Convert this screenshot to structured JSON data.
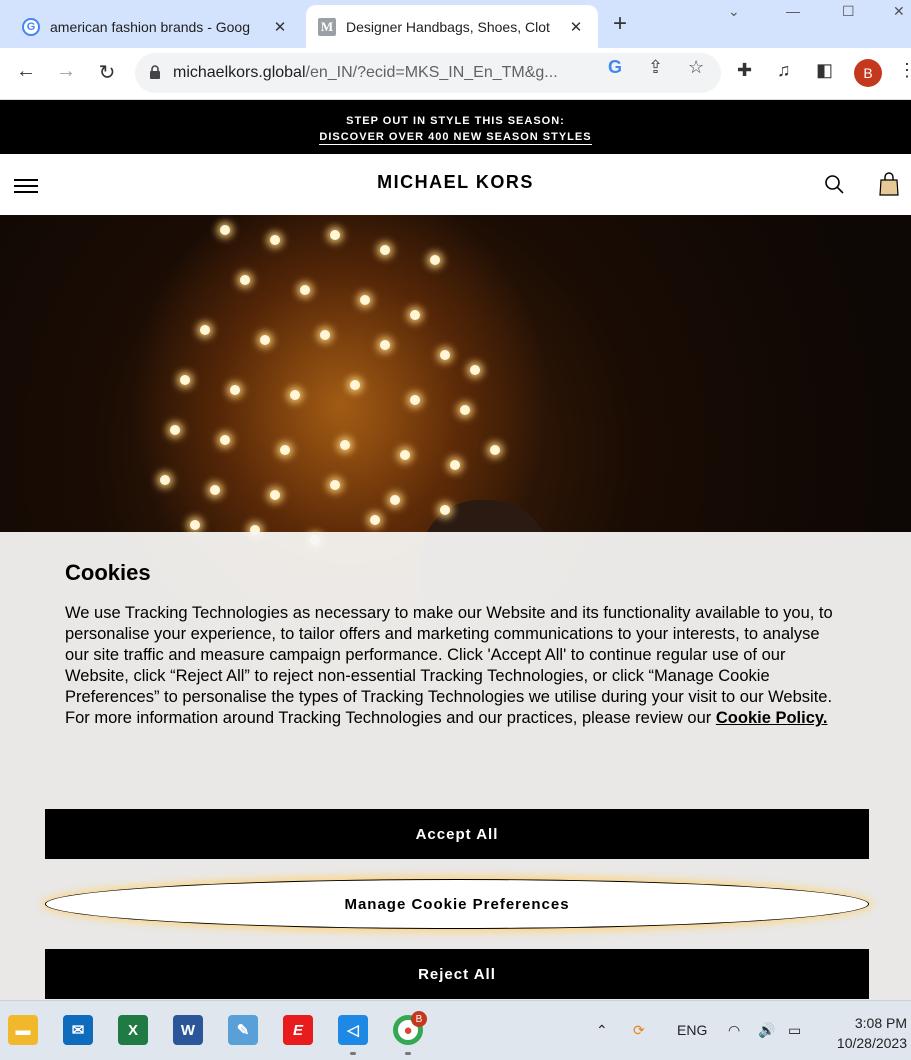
{
  "browser": {
    "tabs": [
      {
        "title": "american fashion brands - Goog",
        "favicon": "G"
      },
      {
        "title": "Designer Handbags, Shoes, Clot",
        "favicon": "M"
      }
    ],
    "url_host": "michaelkors.global",
    "url_path": "/en_IN/?ecid=MKS_IN_En_TM&g...",
    "profile_initial": "B"
  },
  "promo": {
    "line1": "STEP OUT IN STYLE THIS SEASON:",
    "line2": "DISCOVER OVER 400 NEW SEASON STYLES"
  },
  "header": {
    "logo": "MICHAEL KORS"
  },
  "cookie": {
    "title": "Cookies",
    "body": "We use Tracking Technologies as necessary to make our Website and its functionality available to you, to personalise your experience, to tailor offers and marketing communications to your interests, to analyse our site traffic and measure campaign performance. Click 'Accept All' to continue regular use of our Website, click “Reject All” to reject non-essential Tracking Technologies, or click “Manage Cookie Preferences” to personalise the types of Tracking Technologies we utilise during your visit to our Website. For more information around Tracking Technologies and our practices, please review our",
    "policy_link": "Cookie Policy.",
    "accept_label": "Accept All",
    "manage_label": "Manage Cookie Preferences",
    "reject_label": "Reject All"
  },
  "taskbar": {
    "language": "ENG",
    "time": "3:08 PM",
    "date": "10/28/2023",
    "chrome_badge": "B"
  }
}
